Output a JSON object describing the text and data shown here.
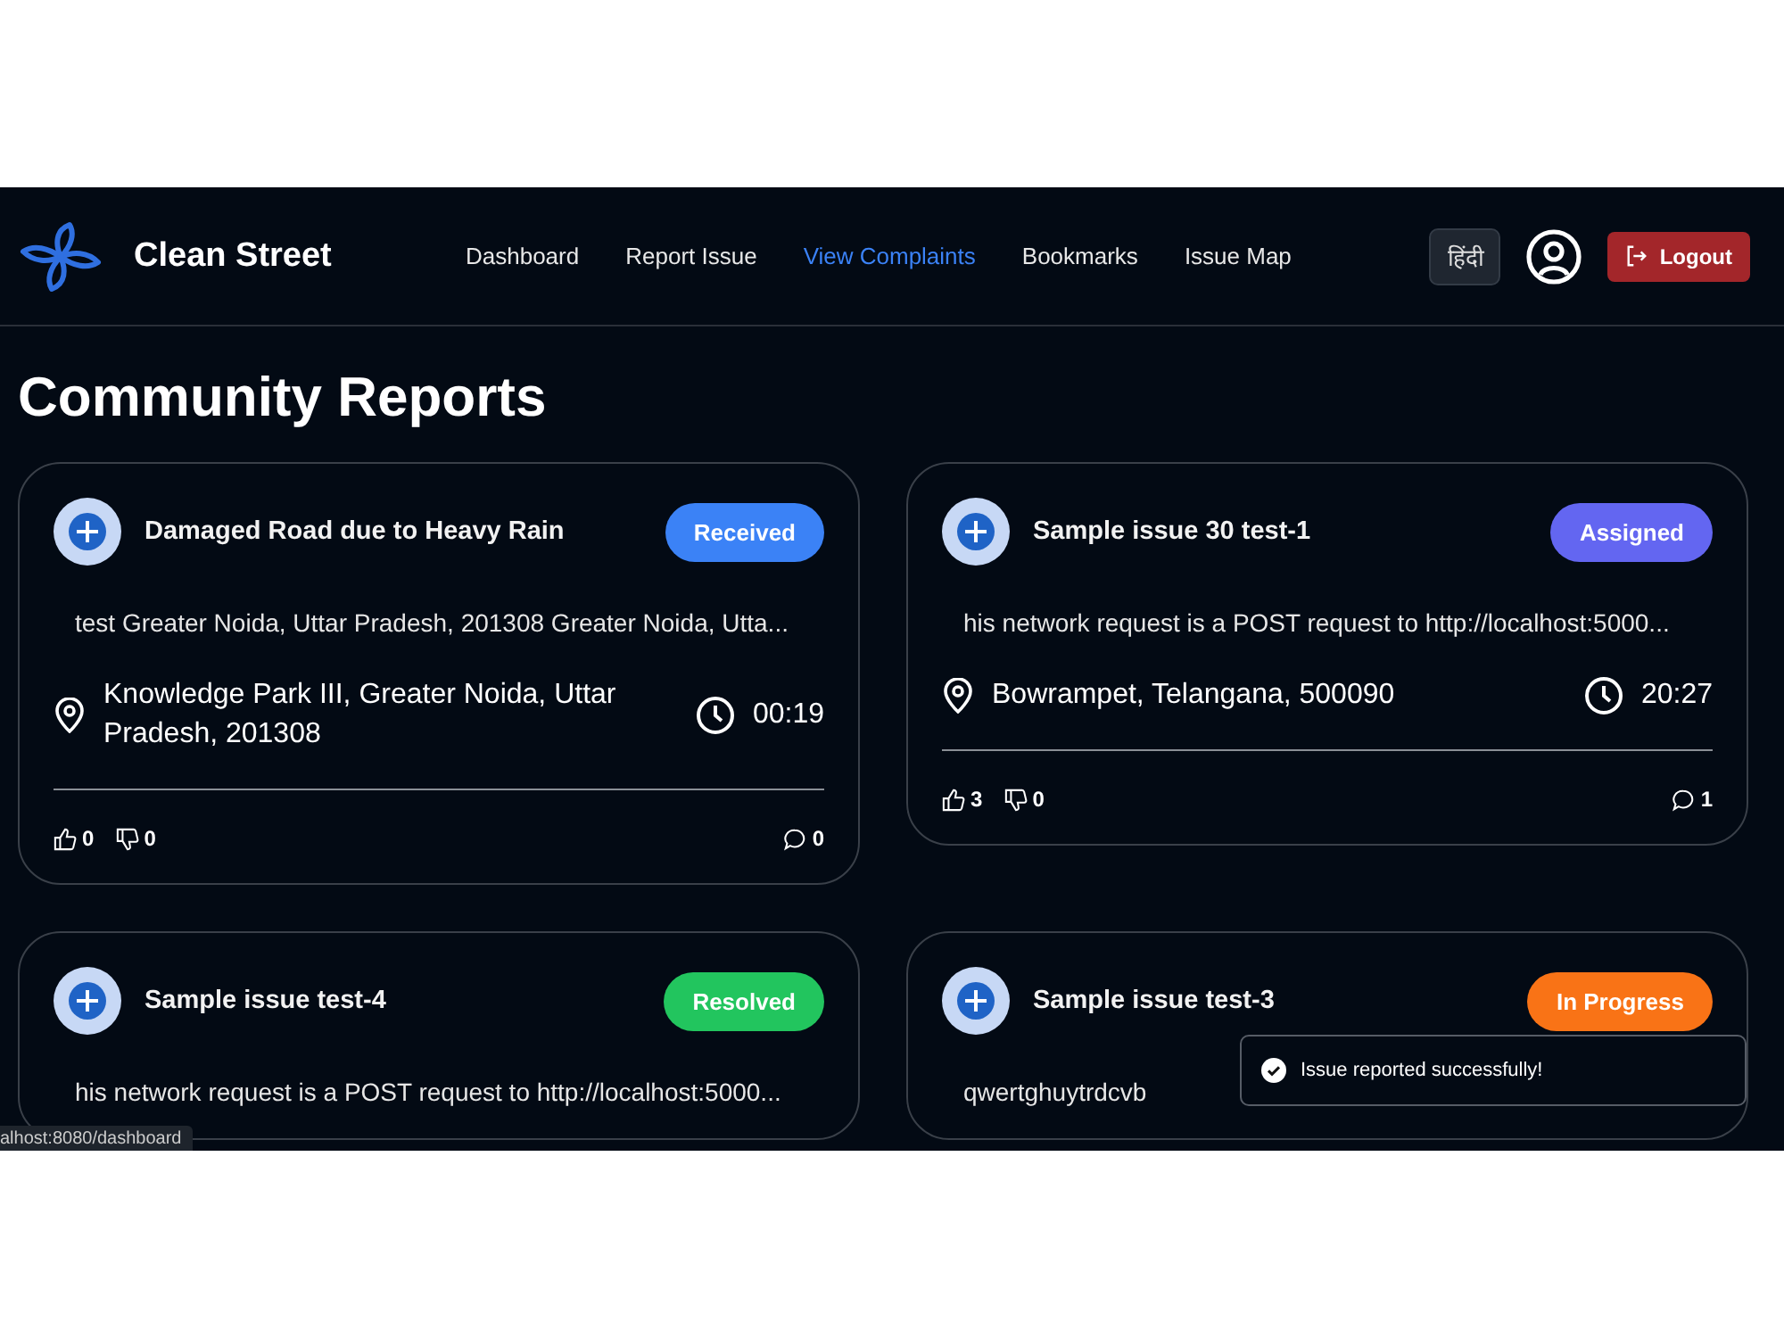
{
  "navbar": {
    "brand": "Clean Street",
    "links": [
      {
        "label": "Dashboard",
        "selected": false
      },
      {
        "label": "Report Issue",
        "selected": false
      },
      {
        "label": "View Complaints",
        "selected": true
      },
      {
        "label": "Bookmarks",
        "selected": false
      },
      {
        "label": "Issue Map",
        "selected": false
      }
    ],
    "language": "हिंदी",
    "logout": "Logout"
  },
  "heading": "Community Reports",
  "reports": [
    {
      "title": "Damaged Road due to Heavy Rain",
      "status": {
        "label": "Received",
        "color": "#3b82f6"
      },
      "description": "test Greater Noida, Uttar Pradesh, 201308 Greater Noida, Utta...",
      "location": "Knowledge Park III, Greater Noida, Uttar Pradesh, 201308",
      "time": "00:19",
      "upvotes": "0",
      "downvotes": "0",
      "comments": "0"
    },
    {
      "title": "Sample issue 30 test-1",
      "status": {
        "label": "Assigned",
        "color": "#6366f1"
      },
      "description": "his network request is a POST request to http://localhost:5000...",
      "location": "Bowrampet, Telangana, 500090",
      "time": "20:27",
      "upvotes": "3",
      "downvotes": "0",
      "comments": "1"
    },
    {
      "title": "Sample issue test-4",
      "status": {
        "label": "Resolved",
        "color": "#22c55e"
      },
      "description": "his network request is a POST request to http://localhost:5000..."
    },
    {
      "title": "Sample issue test-3",
      "status": {
        "label": "In Progress",
        "color": "#f97316"
      },
      "description": "qwertghuytrdcvb"
    }
  ],
  "toast": {
    "message": "Issue reported successfully!"
  },
  "status_bar": "alhost:8080/dashboard"
}
